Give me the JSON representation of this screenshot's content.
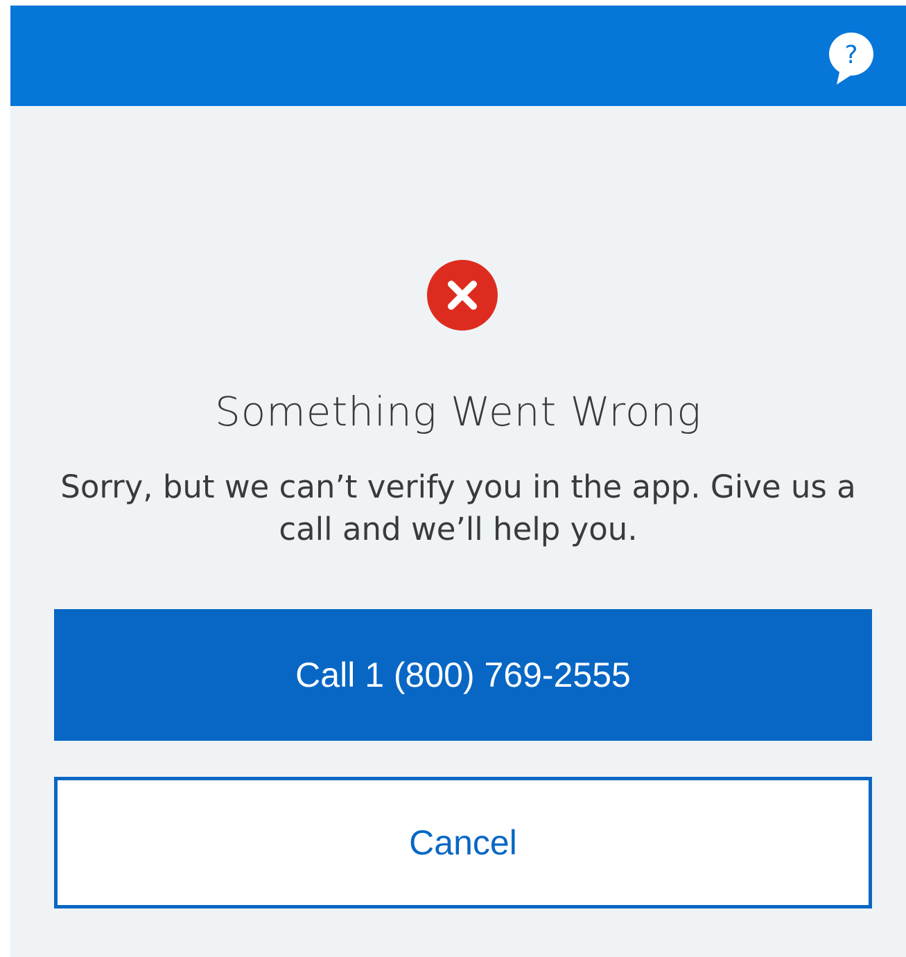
{
  "header": {
    "background_color": "#0776d9",
    "help_icon": "help-chat-bubble-icon"
  },
  "dialog": {
    "status_icon": "error-x-icon",
    "status_color": "#dd2c1f",
    "title": "Something Went Wrong",
    "message": "Sorry, but we can’t verify you in the app. Give us a call and we’ll help you."
  },
  "actions": {
    "call_label": "Call 1 (800) 769-2555",
    "cancel_label": "Cancel",
    "primary_color": "#0867c4"
  }
}
